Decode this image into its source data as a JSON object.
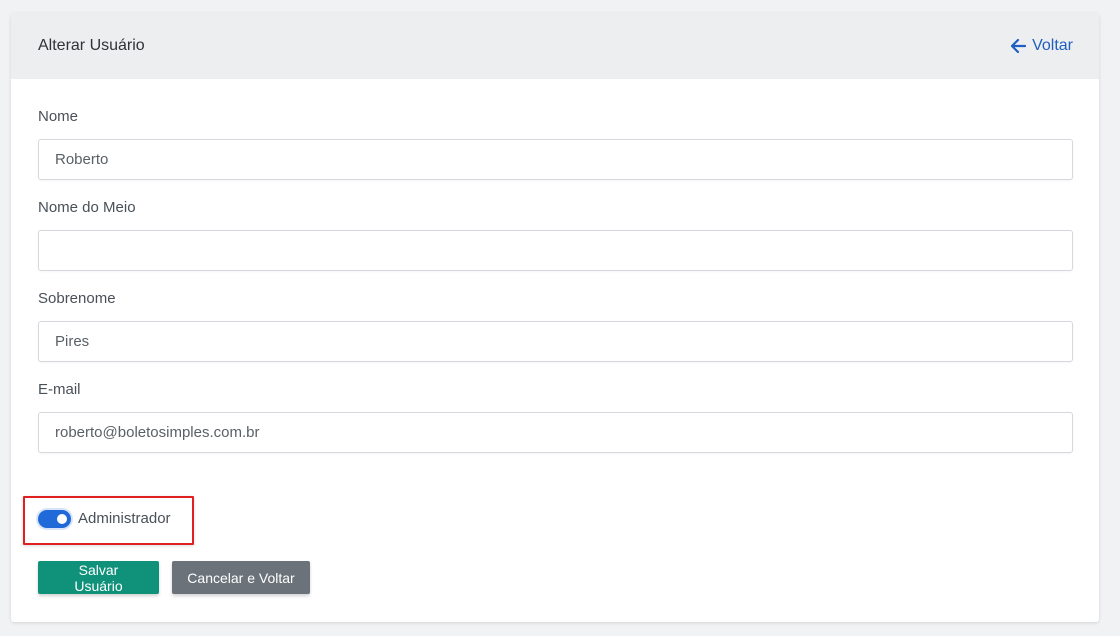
{
  "header": {
    "title": "Alterar Usuário",
    "back_label": "Voltar"
  },
  "form": {
    "fields": [
      {
        "label": "Nome",
        "value": "Roberto",
        "placeholder": ""
      },
      {
        "label": "Nome do Meio",
        "value": "",
        "placeholder": ""
      },
      {
        "label": "Sobrenome",
        "value": "Pires",
        "placeholder": ""
      },
      {
        "label": "E-mail",
        "value": "roberto@boletosimples.com.br",
        "placeholder": ""
      }
    ],
    "admin_toggle": {
      "label": "Administrador",
      "checked": true
    }
  },
  "actions": {
    "save_label": "Salvar Usuário",
    "cancel_label": "Cancelar e Voltar"
  },
  "colors": {
    "primary": "#10917a",
    "secondary": "#6b727a",
    "link": "#1f5fbf",
    "toggle_on": "#1f6ad8",
    "highlight": "#e02020"
  },
  "icons": {
    "back": "arrow-left-icon"
  }
}
